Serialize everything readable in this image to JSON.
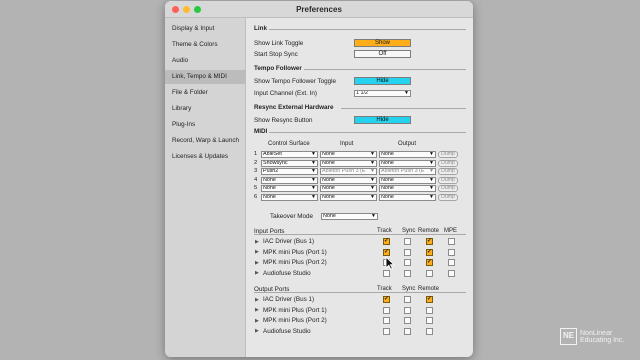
{
  "window": {
    "title": "Preferences"
  },
  "sidebar": {
    "items": [
      {
        "label": "Display & Input"
      },
      {
        "label": "Theme & Colors"
      },
      {
        "label": "Audio"
      },
      {
        "label": "Link, Tempo & MIDI",
        "active": true
      },
      {
        "label": "File & Folder"
      },
      {
        "label": "Library"
      },
      {
        "label": "Plug-Ins"
      },
      {
        "label": "Record, Warp & Launch"
      },
      {
        "label": "Licenses & Updates"
      }
    ]
  },
  "link": {
    "title": "Link",
    "show_link_toggle_label": "Show Link Toggle",
    "show_link_toggle_value": "Show",
    "start_stop_sync_label": "Start Stop Sync",
    "start_stop_sync_value": "Off"
  },
  "tempo_follower": {
    "title": "Tempo Follower",
    "toggle_label": "Show Tempo Follower Toggle",
    "toggle_value": "Hide",
    "input_channel_label": "Input Channel (Ext. In)",
    "input_channel_value": "1 1/2"
  },
  "resync": {
    "title": "Resync External Hardware",
    "button_label": "Show Resync Button",
    "button_value": "Hide"
  },
  "midi": {
    "title": "MIDI",
    "headers": {
      "control_surface": "Control Surface",
      "input": "Input",
      "output": "Output"
    },
    "rows": [
      {
        "num": "1",
        "surface": "AbleSet",
        "input": "None",
        "output": "None",
        "dump": "Dump",
        "dim": false
      },
      {
        "num": "2",
        "surface": "Showsync",
        "input": "None",
        "output": "None",
        "dump": "Dump",
        "dim": false
      },
      {
        "num": "3",
        "surface": "Push2",
        "input": "Ableton Push 3 (E",
        "output": "Ableton Push 3 (E",
        "dump": "Dump",
        "dim": true
      },
      {
        "num": "4",
        "surface": "None",
        "input": "None",
        "output": "None",
        "dump": "Dump",
        "dim": false
      },
      {
        "num": "5",
        "surface": "None",
        "input": "None",
        "output": "None",
        "dump": "Dump",
        "dim": false
      },
      {
        "num": "6",
        "surface": "None",
        "input": "None",
        "output": "None",
        "dump": "Dump",
        "dim": false
      }
    ],
    "takeover_label": "Takeover Mode",
    "takeover_value": "None"
  },
  "input_ports": {
    "title": "Input Ports",
    "headers": [
      "Track",
      "Sync",
      "Remote",
      "MPE"
    ],
    "rows": [
      {
        "name": "IAC Driver (Bus 1)",
        "checks": [
          true,
          false,
          true,
          false
        ]
      },
      {
        "name": "MPK mini Plus (Port 1)",
        "checks": [
          true,
          false,
          true,
          false
        ]
      },
      {
        "name": "MPK mini Plus (Port 2)",
        "checks": [
          false,
          false,
          true,
          false
        ]
      },
      {
        "name": "Audiofuse Studio",
        "checks": [
          false,
          false,
          false,
          false
        ]
      }
    ]
  },
  "output_ports": {
    "title": "Output Ports",
    "headers": [
      "Track",
      "Sync",
      "Remote"
    ],
    "rows": [
      {
        "name": "IAC Driver (Bus 1)",
        "checks": [
          true,
          false,
          true
        ]
      },
      {
        "name": "MPK mini Plus (Port 1)",
        "checks": [
          false,
          false,
          false
        ]
      },
      {
        "name": "MPK mini Plus (Port 2)",
        "checks": [
          false,
          false,
          false
        ]
      },
      {
        "name": "Audiofuse Studio",
        "checks": [
          false,
          false,
          false
        ]
      }
    ]
  },
  "watermark": {
    "logo_letters": "NE",
    "line1": "NonLinear",
    "line2": "Educating Inc."
  },
  "colors": {
    "accent_orange": "#ffae1a",
    "accent_cyan": "#26d3ee"
  }
}
